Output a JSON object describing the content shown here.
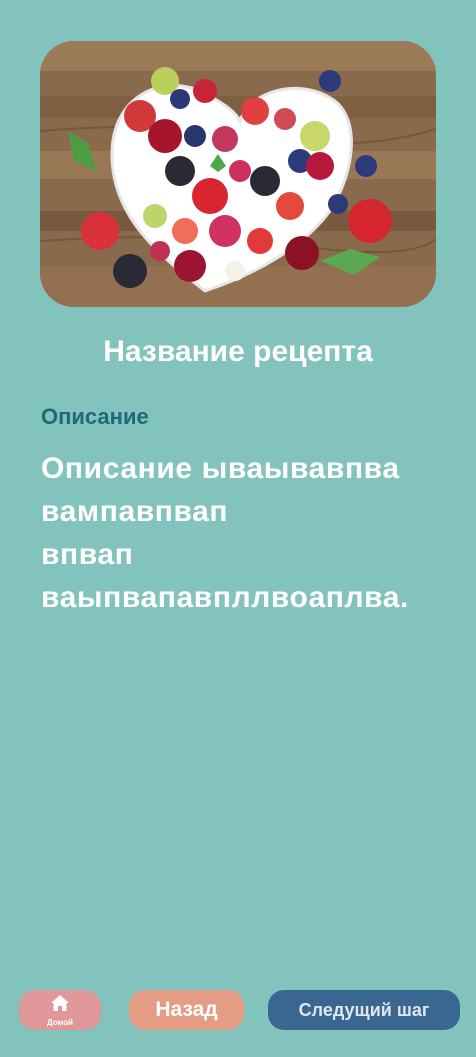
{
  "recipe": {
    "title": "Название рецепта",
    "description_label": "Описание",
    "description_text": "Описание ываывавпва вампавпвап\nвпвап ваыпвапавпллвоаплва."
  },
  "nav": {
    "home_label": "Домой",
    "back_label": "Назад",
    "next_label": "Следущий шаг"
  },
  "colors": {
    "background": "#82c3bd",
    "description_label": "#1d6a78",
    "home_button": "#e0979a",
    "back_button": "#e59c85",
    "next_button": "#396792"
  },
  "icons": {
    "home": "home-icon"
  }
}
